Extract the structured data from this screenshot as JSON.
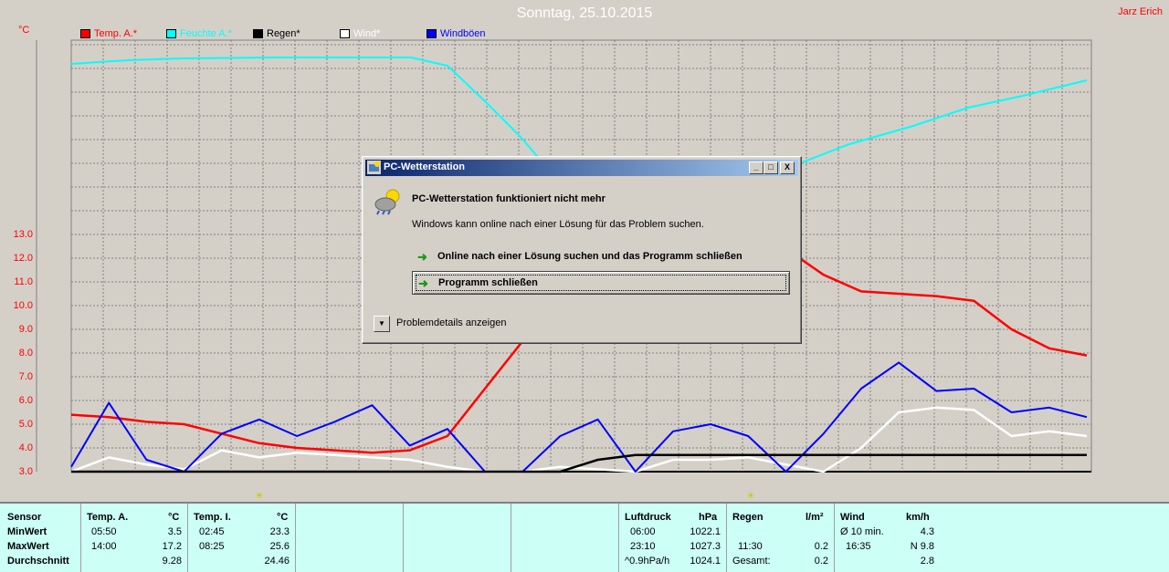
{
  "chart": {
    "title": "Sonntag, 25.10.2015",
    "author": "Jarz Erich",
    "unit": "°C",
    "legend": [
      {
        "label": "Temp. A.*",
        "color": "#ff0000"
      },
      {
        "label": "Feuchte A.*",
        "color": "#00ffff"
      },
      {
        "label": "Regen*",
        "color": "#000000"
      },
      {
        "label": "Wind*",
        "color": "#ffffff"
      },
      {
        "label": "Windböen",
        "color": "#0000ff"
      }
    ],
    "yticks": [
      "13.0",
      "12.0",
      "11.0",
      "10.0",
      "9.0",
      "8.0",
      "7.0",
      "6.0",
      "5.0",
      "4.0",
      "3.0"
    ]
  },
  "chart_data": {
    "type": "line",
    "ylim": [
      3.0,
      13.0
    ],
    "series": [
      {
        "name": "Temp. A.*",
        "color": "#ff0000",
        "values": [
          5.4,
          5.3,
          5.1,
          5.0,
          4.6,
          4.2,
          4.0,
          3.9,
          3.8,
          3.9,
          4.5,
          6.5,
          8.5,
          10.2,
          11.8,
          13.2,
          14.5,
          14.8,
          13.5,
          12.4,
          11.3,
          10.6,
          10.5,
          10.4,
          10.2,
          9.0,
          8.2,
          7.9
        ]
      },
      {
        "name": "Wind*",
        "color": "#ffffff",
        "values": [
          3.0,
          3.6,
          3.3,
          3.1,
          3.9,
          3.6,
          3.8,
          3.7,
          3.6,
          3.5,
          3.2,
          3.0,
          3.0,
          3.2,
          3.1,
          3.0,
          3.5,
          3.5,
          3.6,
          3.3,
          3.0,
          4.0,
          5.5,
          5.7,
          5.6,
          4.5,
          4.7,
          4.5
        ]
      },
      {
        "name": "Windböen",
        "color": "#0000ff",
        "values": [
          3.2,
          5.9,
          3.5,
          3.0,
          4.6,
          5.2,
          4.5,
          5.1,
          5.8,
          4.1,
          4.8,
          3.0,
          3.0,
          4.5,
          5.2,
          3.0,
          4.7,
          5.0,
          4.5,
          3.0,
          4.6,
          6.5,
          7.6,
          6.4,
          6.5,
          5.5,
          5.7,
          5.3
        ]
      },
      {
        "name": "Regen*",
        "color": "#000000",
        "values": [
          3.0,
          3.0,
          3.0,
          3.0,
          3.0,
          3.0,
          3.0,
          3.0,
          3.0,
          3.0,
          3.0,
          3.0,
          3.0,
          3.0,
          3.5,
          3.7,
          3.7,
          3.7,
          3.7,
          3.7,
          3.7,
          3.7,
          3.7,
          3.7,
          3.7,
          3.7,
          3.7,
          3.7
        ]
      }
    ]
  },
  "panel": {
    "sensor": {
      "header": "Sensor",
      "min": "MinWert",
      "max": "MaxWert",
      "avg": "Durchschnitt"
    },
    "tempA": {
      "header": "Temp. A.",
      "unit": "°C",
      "min_time": "05:50",
      "min_val": "3.5",
      "max_time": "14:00",
      "max_val": "17.2",
      "avg": "9.28"
    },
    "tempI": {
      "header": "Temp. I.",
      "unit": "°C",
      "min_time": "02:45",
      "min_val": "23.3",
      "max_time": "08:25",
      "max_val": "25.6",
      "avg": "24.46"
    },
    "pressure": {
      "header": "Luftdruck",
      "unit": "hPa",
      "min_time": "06:00",
      "min_val": "1022.1",
      "max_time": "23:10",
      "max_val": "1027.3",
      "trend": "^0.9hPa/h",
      "avg": "1024.1"
    },
    "rain": {
      "header": "Regen",
      "unit": "l/m²",
      "time": "11:30",
      "val": "0.2",
      "total_label": "Gesamt:",
      "total": "0.2"
    },
    "wind": {
      "header": "Wind",
      "unit": "km/h",
      "avg_label": "Ø 10 min.",
      "avg_val": "4.3",
      "gust_time": "16:35",
      "gust_val": "N 9.8",
      "day_avg": "2.8"
    }
  },
  "dialog": {
    "title": "PC-Wetterstation",
    "heading": "PC-Wetterstation funktioniert nicht mehr",
    "text": "Windows kann online nach einer Lösung für das Problem suchen.",
    "option_online": "Online nach einer Lösung suchen und das Programm schließen",
    "option_close": "Programm schließen",
    "details": "Problemdetails anzeigen",
    "btn_min": "_",
    "btn_max": "□",
    "btn_close": "X"
  }
}
